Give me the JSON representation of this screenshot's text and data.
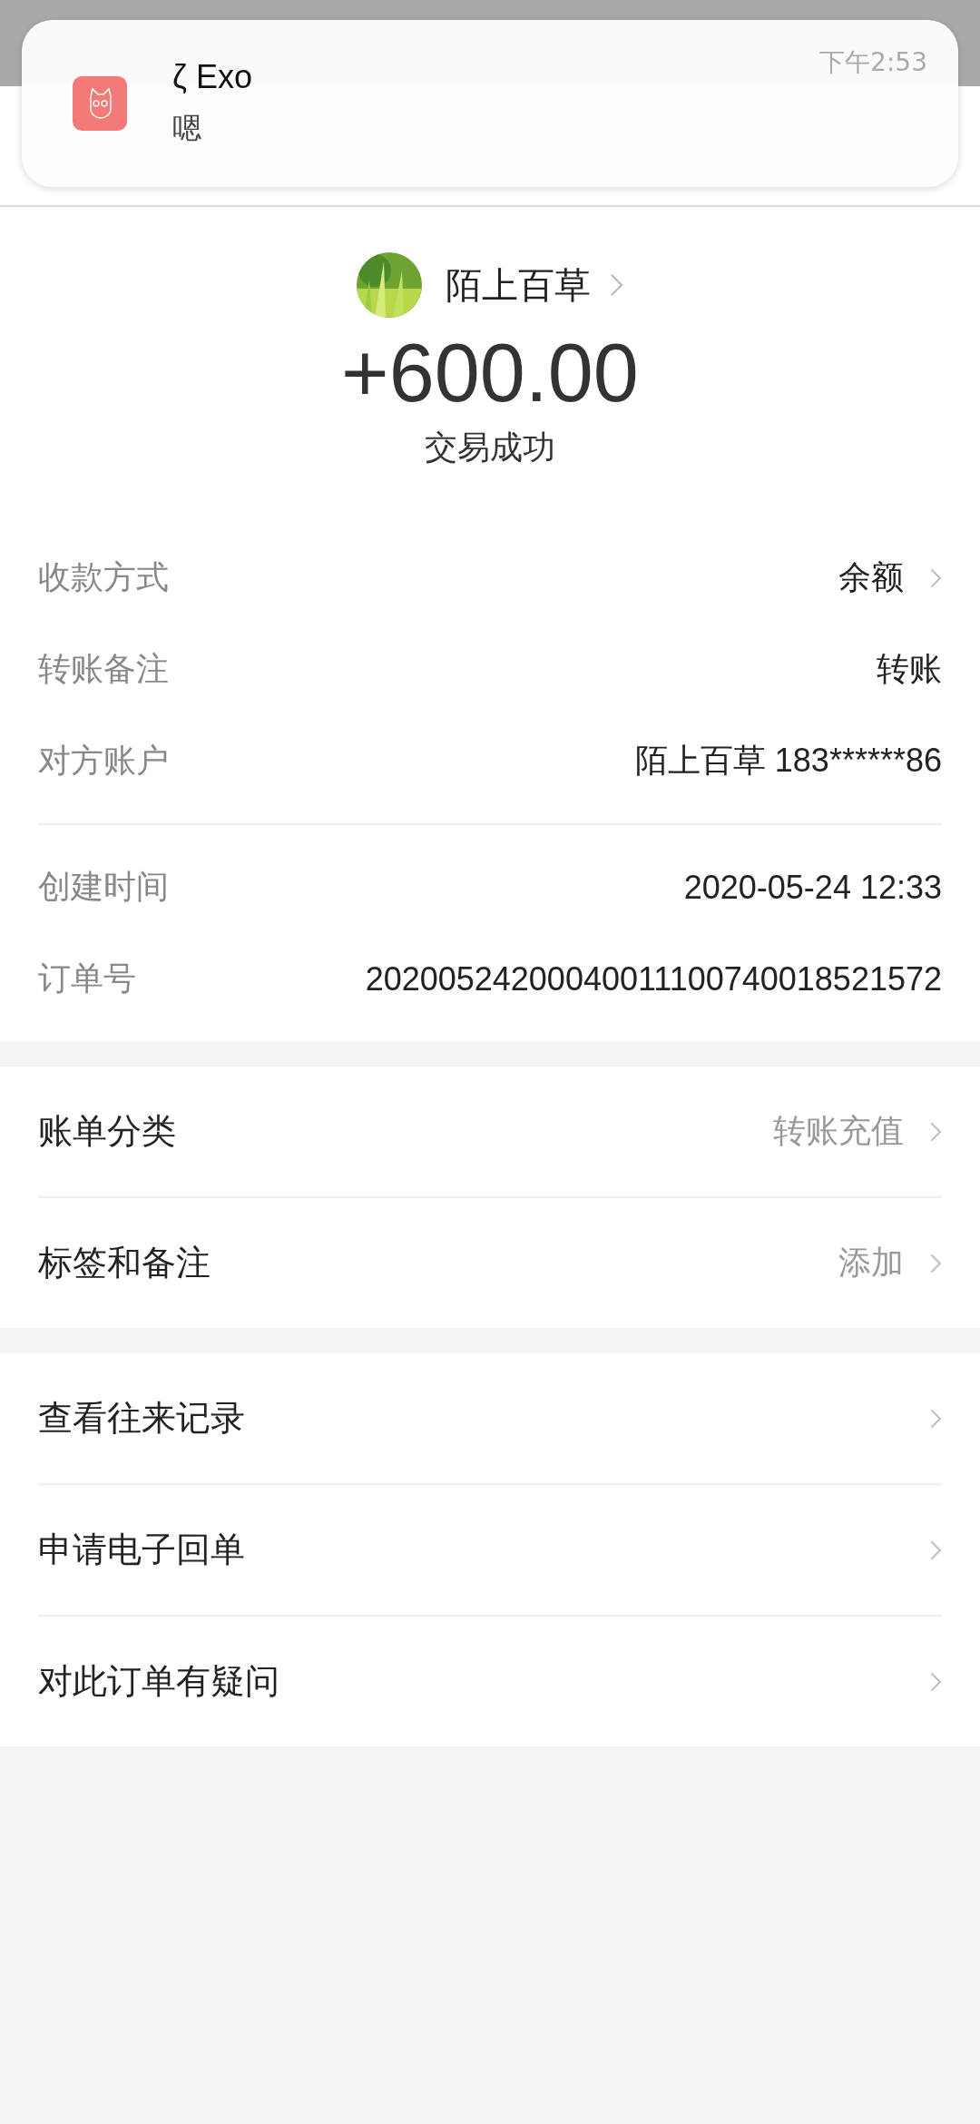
{
  "notification": {
    "app_name": "ζ Exo",
    "message": "嗯",
    "time": "下午2:53"
  },
  "payee": {
    "name": "陌上百草"
  },
  "amount": "+600.00",
  "status": "交易成功",
  "details": [
    [
      {
        "label": "收款方式",
        "value": "余额",
        "arrow": true
      },
      {
        "label": "转账备注",
        "value": "转账",
        "arrow": false
      },
      {
        "label": "对方账户",
        "value": "陌上百草 183******86",
        "arrow": false
      }
    ],
    [
      {
        "label": "创建时间",
        "value": "2020-05-24 12:33",
        "arrow": false
      },
      {
        "label": "订单号",
        "value": "20200524200040011100740018521572",
        "arrow": false
      }
    ]
  ],
  "menus": [
    [
      {
        "label": "账单分类",
        "value": "转账充值"
      },
      {
        "label": "标签和备注",
        "value": "添加"
      }
    ],
    [
      {
        "label": "查看往来记录"
      },
      {
        "label": "申请电子回单"
      },
      {
        "label": "对此订单有疑问"
      }
    ]
  ]
}
